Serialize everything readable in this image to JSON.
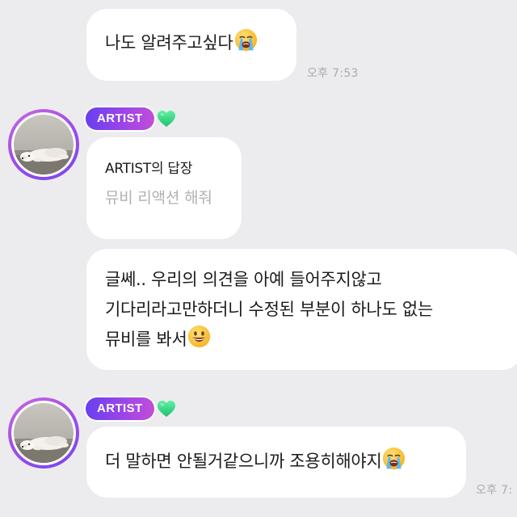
{
  "messages": [
    {
      "text": "나도 알려주고싶다",
      "emoji": "loudly-crying-face-emoji",
      "time": "오후 7:53"
    },
    {
      "sender_badge": "ARTIST",
      "sender_emoji": "green-heart-emoji",
      "reply_title": "ARTIST의 답장",
      "reply_quote": "뮤비 리액션 해줘"
    },
    {
      "lines": [
        "글쎄.. 우리의 의견을 아예 들어주지않고",
        "기다리라고만하더니 수정된 부분이 하나도 없는",
        "뮤비를 봐서"
      ],
      "emoji": "grinning-face-emoji"
    },
    {
      "sender_badge": "ARTIST",
      "sender_emoji": "green-heart-emoji",
      "text": "더 말하면 안될거같으니까 조용히해야지",
      "emoji": "loudly-crying-face-emoji",
      "time": "오후 7:"
    }
  ],
  "colors": {
    "background": "#ececef",
    "bubble": "#ffffff",
    "badge_gradient_start": "#6840f0",
    "badge_gradient_end": "#c24ed8",
    "heart": "#2fd181",
    "timestamp": "#a9a9b0",
    "reply_quote": "#b1b1b6"
  }
}
